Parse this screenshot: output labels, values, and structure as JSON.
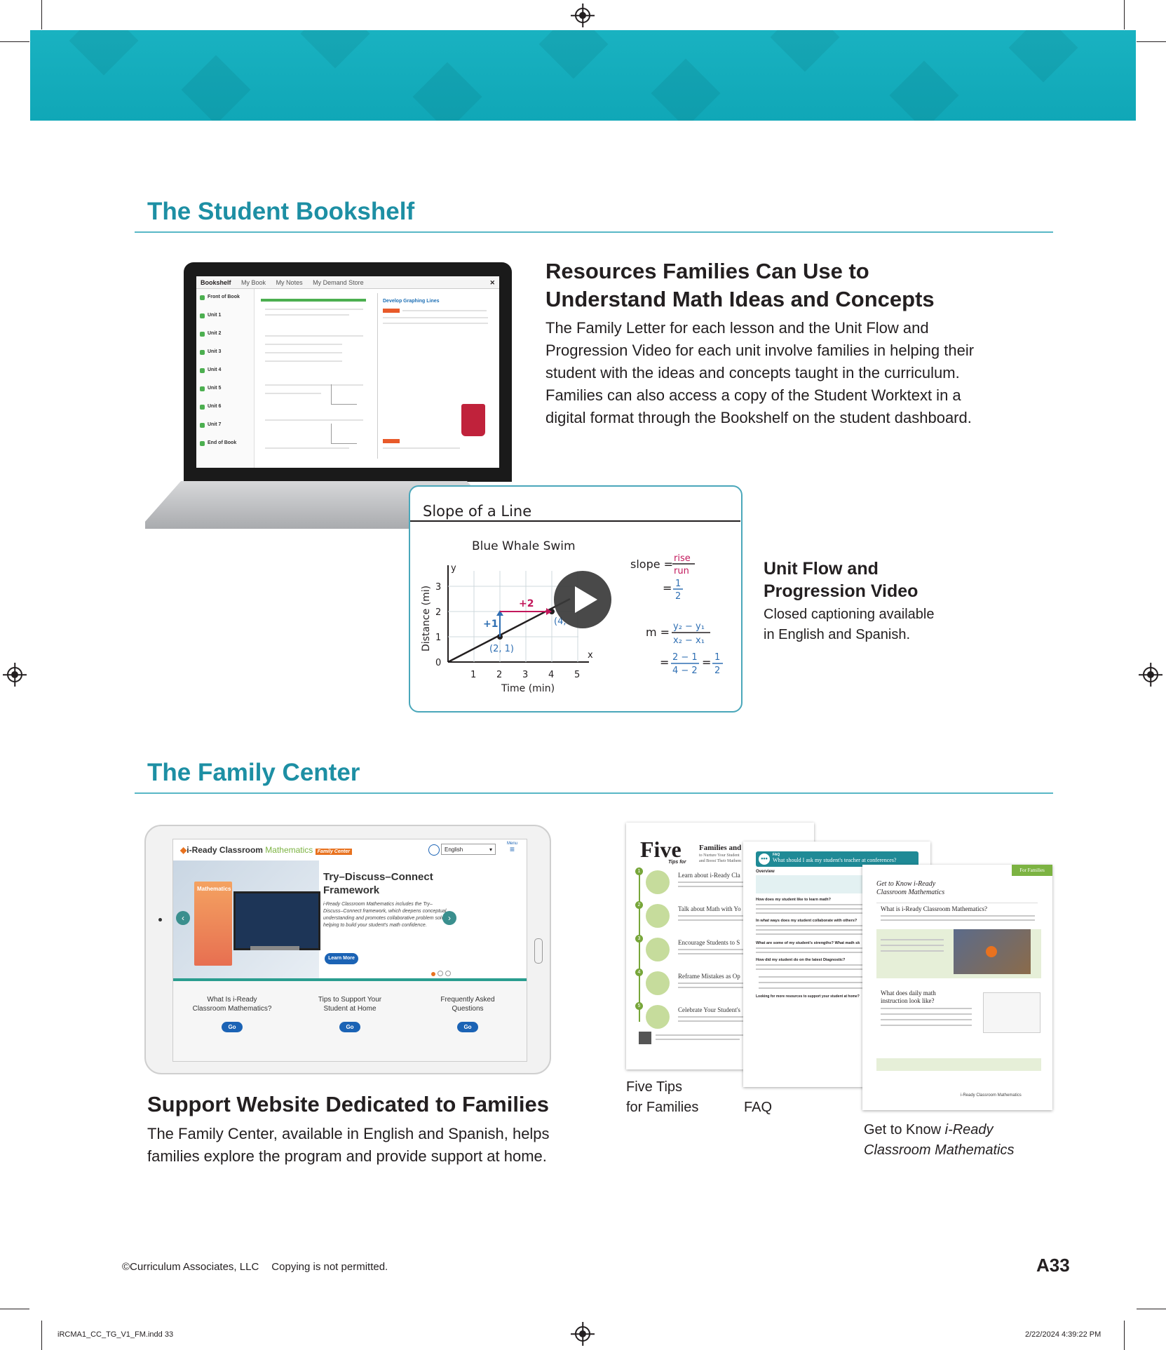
{
  "student_bookshelf": {
    "section_title": "The Student Bookshelf",
    "heading_line1": "Resources Families Can Use to",
    "heading_line2": "Understand Math Ideas and Concepts",
    "body_lines": [
      "The Family Letter for each lesson and the Unit Flow and",
      "Progression Video for each unit involve families in helping their",
      "student with the ideas and concepts taught in the curriculum.",
      "Families can also access a copy of the Student Worktext in a",
      "digital format through the Bookshelf on the student dashboard."
    ],
    "screen": {
      "title": "Bookshelf",
      "tabs": [
        "My Book",
        "My Notes",
        "My Demand Store"
      ],
      "front": "Front of Book",
      "units": [
        "Unit 1",
        "Unit 2",
        "Unit 3",
        "Unit 4",
        "Unit 5",
        "Unit 6",
        "Unit 7"
      ],
      "end": "End of Book",
      "page_heading": "Develop Graphing Lines"
    }
  },
  "video": {
    "title": "Slope of a Line",
    "graph_title": "Blue Whale Swim",
    "y_axis_label": "Distance (mi)",
    "x_axis_label": "Time (min)",
    "y_ticks": [
      "3",
      "2",
      "1",
      "0"
    ],
    "x_ticks": [
      "1",
      "2",
      "3",
      "4",
      "5"
    ],
    "axis_x": "x",
    "axis_y": "y",
    "point1": "(2, 1)",
    "point2": "(4,",
    "rise_label": "+1",
    "run_label": "+2",
    "slope_word": "slope =",
    "rise": "rise",
    "run": "run",
    "equals": "=",
    "one": "1",
    "two": "2",
    "m_eq": "m =",
    "y2_minus_y1": "y₂ − y₁",
    "x2_minus_x1": "x₂ − x₁",
    "num": "2 − 1",
    "den": "4 − 2",
    "caption_title_line1": "Unit Flow and",
    "caption_title_line2": "Progression Video",
    "caption_body_line1": "Closed captioning available",
    "caption_body_line2": "in English and Spanish."
  },
  "family_center": {
    "section_title": "The Family Center",
    "heading": "Support Website Dedicated to Families",
    "body_line1": "The Family Center, available in English and Spanish, helps",
    "body_line2": "families explore the program and provide support at home.",
    "tablet": {
      "brand_bold": "i-Ready Classroom",
      "brand_light": "Mathematics",
      "brand_tag": "Family Center",
      "language": "English",
      "menu": "Menu",
      "book_label": "Mathematics",
      "hero_title_line1": "Try–Discuss–Connect",
      "hero_title_line2": "Framework",
      "hero_body": "i-Ready Classroom Mathematics includes the Try–Discuss–Connect framework, which deepens conceptual understanding and promotes collaborative problem solving, helping to build your student's math confidence.",
      "learn_more": "Learn More",
      "cards": [
        {
          "line1": "What Is i-Ready",
          "line2": "Classroom Mathematics?",
          "button": "Go"
        },
        {
          "line1": "Tips to Support Your",
          "line2": "Student at Home",
          "button": "Go"
        },
        {
          "line1": "Frequently Asked",
          "line2": "Questions",
          "button": "Go"
        }
      ]
    },
    "five_tips": {
      "big_word": "Five",
      "sub_word": "Tips for",
      "header_line1": "Families and",
      "header_line2": "to Nurture Your Student",
      "header_line3": "and Boost Their Mathem",
      "tips": [
        "Learn about i-Ready Cla",
        "Talk about Math with Yo",
        "Encourage Students to S",
        "Reframe Mistakes as Op",
        "Celebrate Your Student's"
      ],
      "tip_numbers": [
        "1",
        "2",
        "3",
        "4",
        "5"
      ],
      "caption_line1": "Five Tips",
      "caption_line2": "for Families"
    },
    "faq": {
      "banner_small": "FAQ",
      "banner": "What should I ask my student's teacher at conferences?",
      "overview": "Overview",
      "q1": "How does my student like to learn math?",
      "q2": "In what ways does my student collaborate with others?",
      "q3": "What are some of my student's strengths? What math sk",
      "q4": "How did my student do on the latest Diagnostic?",
      "q5": "Looking for more resources to support your student at home?",
      "caption": "FAQ"
    },
    "get_to_know": {
      "tab": "For Families",
      "title_line1": "Get to Know i-Ready",
      "title_line2": "Classroom Mathematics",
      "q1": "What is i-Ready Classroom Mathematics?",
      "q2_line1": "What does daily math",
      "q2_line2": "instruction look like?",
      "footer_brand": "i-Ready Classroom Mathematics",
      "caption_line1_plain": "Get to Know ",
      "caption_line1_italic": "i-Ready",
      "caption_line2_italic": "Classroom Mathematics"
    }
  },
  "footer": {
    "copyright": "©Curriculum Associates, LLC",
    "notice": "Copying is not permitted.",
    "page_number": "A33"
  },
  "slug": {
    "file": "iRCMA1_CC_TG_V1_FM.indd   33",
    "timestamp": "2/22/2024   4:39:22 PM"
  },
  "colors": {
    "banner": "#13abbb",
    "section_title": "#1d8fa4",
    "rule": "#58b7c6",
    "text": "#231f20",
    "video_border": "#4aa7ba",
    "accent_green": "#77a63a",
    "button_blue": "#1b63b5"
  }
}
